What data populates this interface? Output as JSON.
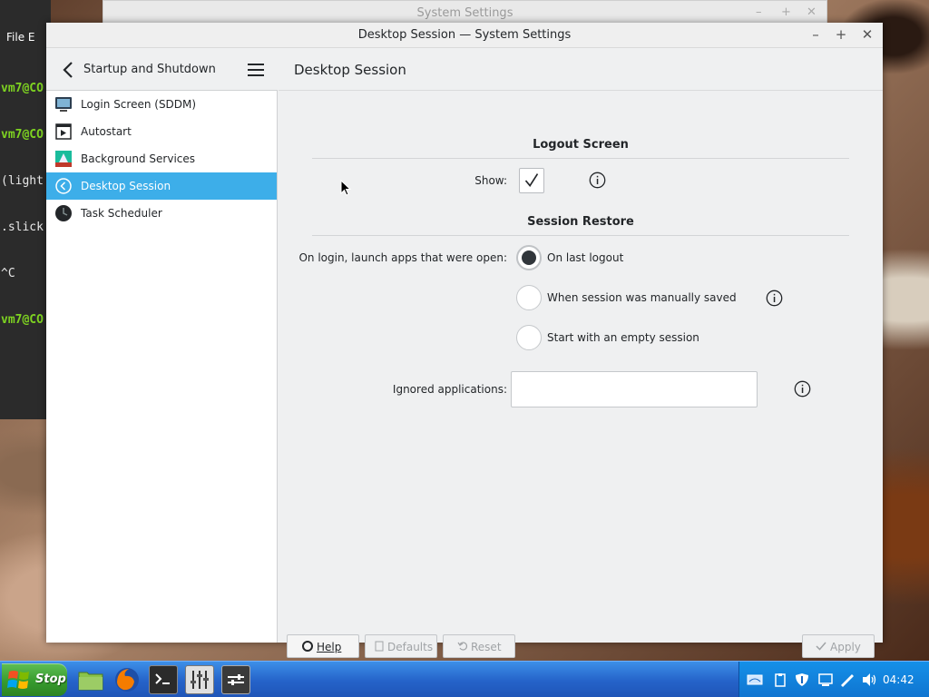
{
  "terminal": {
    "menu": "File  E",
    "lines": [
      {
        "text": "vm7@CO",
        "color": "green"
      },
      {
        "text": "vm7@CO",
        "color": "green"
      },
      {
        "text": "(light",
        "color": "white"
      },
      {
        "text": ".slick",
        "color": "white"
      },
      {
        "text": "^C",
        "color": "white"
      },
      {
        "text": "vm7@CO",
        "color": "green"
      }
    ]
  },
  "background_window": {
    "title": "System Settings"
  },
  "window": {
    "title": "Desktop Session — System Settings"
  },
  "sidebar": {
    "header_title": "Startup and Shutdown",
    "items": [
      {
        "label": "Login Screen (SDDM)",
        "icon": "monitor-icon",
        "active": false
      },
      {
        "label": "Autostart",
        "icon": "autostart-icon",
        "active": false
      },
      {
        "label": "Background Services",
        "icon": "services-icon",
        "active": false
      },
      {
        "label": "Desktop Session",
        "icon": "session-icon",
        "active": true
      },
      {
        "label": "Task Scheduler",
        "icon": "clock-icon",
        "active": false
      }
    ]
  },
  "content": {
    "title": "Desktop Session",
    "logout_section": {
      "title": "Logout Screen",
      "show_label": "Show:",
      "show_checked": true
    },
    "restore_section": {
      "title": "Session Restore",
      "launch_label": "On login, launch apps that were open:",
      "options": [
        {
          "label": "On last logout",
          "selected": true
        },
        {
          "label": "When session was manually saved",
          "selected": false
        },
        {
          "label": "Start with an empty session",
          "selected": false
        }
      ],
      "ignored_label": "Ignored applications:",
      "ignored_value": ""
    }
  },
  "buttons": {
    "help": "Help",
    "defaults": "Defaults",
    "reset": "Reset",
    "apply": "Apply"
  },
  "taskbar": {
    "start_label": "Stop",
    "apps": [
      "file-manager-icon",
      "firefox-icon",
      "terminal-icon",
      "mixer-icon",
      "settings-icon"
    ],
    "clock": "04:42"
  },
  "colors": {
    "accent": "#3daee9",
    "taskbar": "#2563c9",
    "start": "#379b2e"
  }
}
